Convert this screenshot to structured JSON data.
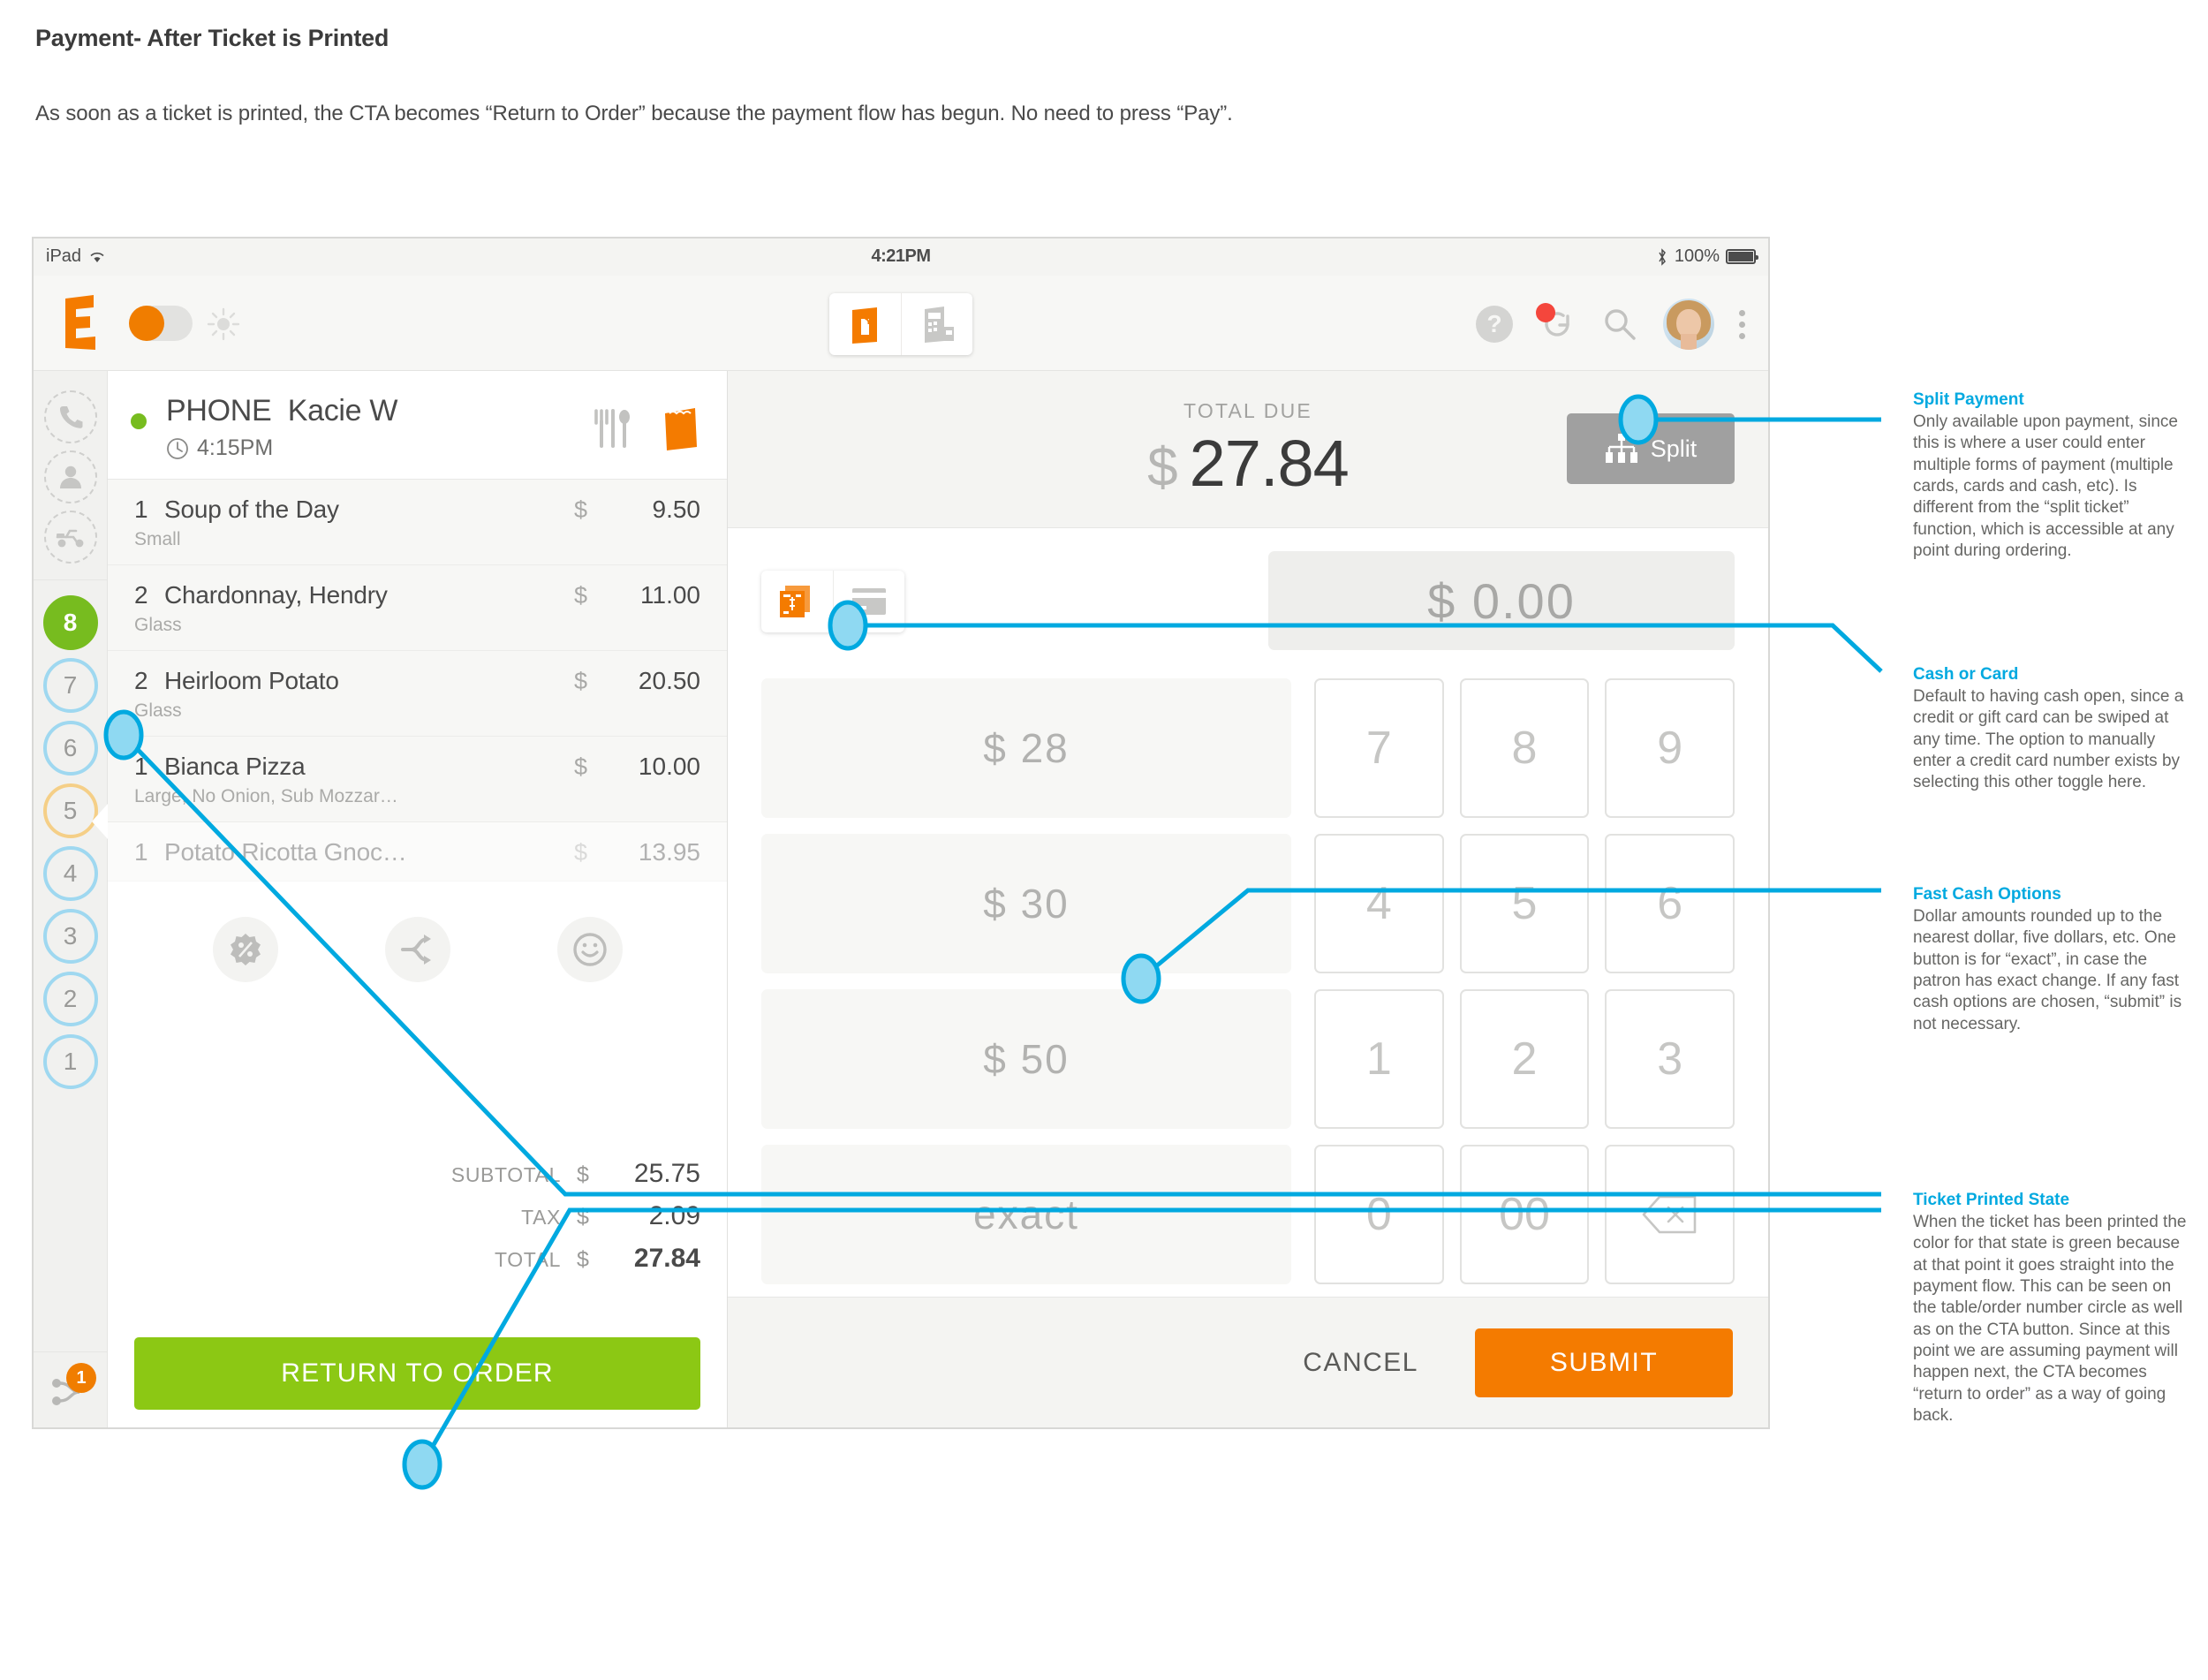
{
  "page": {
    "title": "Payment- After Ticket is Printed",
    "subtitle": "As soon as a ticket is printed, the CTA becomes “Return to Order” because the payment flow has begun. No need to press “Pay”."
  },
  "statusbar": {
    "device": "iPad",
    "time": "4:21PM",
    "battery": "100%"
  },
  "toolbar": {
    "logo": "E",
    "mode_tabs": [
      "order-bag-icon",
      "register-icon"
    ]
  },
  "rail": {
    "top_icons": [
      "phone-icon",
      "person-icon",
      "delivery-scooter-icon"
    ],
    "numbers": [
      {
        "label": "8",
        "state": "green"
      },
      {
        "label": "7",
        "state": "blue"
      },
      {
        "label": "6",
        "state": "blue"
      },
      {
        "label": "5",
        "state": "yellow"
      },
      {
        "label": "4",
        "state": "blue"
      },
      {
        "label": "3",
        "state": "blue"
      },
      {
        "label": "2",
        "state": "blue"
      },
      {
        "label": "1",
        "state": "blue"
      }
    ],
    "bottom_badge": "1"
  },
  "ticket": {
    "order_type": "PHONE",
    "customer": "Kacie W",
    "time": "4:15PM",
    "items": [
      {
        "qty": "1",
        "name": "Soup of the Day",
        "currency": "$",
        "price": "9.50",
        "mod": "Small",
        "faded": false
      },
      {
        "qty": "2",
        "name": "Chardonnay, Hendry",
        "currency": "$",
        "price": "11.00",
        "mod": "Glass",
        "faded": false
      },
      {
        "qty": "2",
        "name": "Heirloom Potato",
        "currency": "$",
        "price": "20.50",
        "mod": "Glass",
        "faded": false
      },
      {
        "qty": "1",
        "name": "Bianca Pizza",
        "currency": "$",
        "price": "10.00",
        "mod": "Large, No Onion, Sub Mozzar…",
        "faded": false
      },
      {
        "qty": "1",
        "name": "Potato Ricotta Gnoc…",
        "currency": "$",
        "price": "13.95",
        "mod": "",
        "faded": true
      }
    ],
    "actions": [
      "discount-icon",
      "split-ticket-icon",
      "smiley-icon"
    ],
    "totals": [
      {
        "label": "SUBTOTAL",
        "currency": "$",
        "value": "25.75",
        "bold": false
      },
      {
        "label": "TAX",
        "currency": "$",
        "value": "2.09",
        "bold": false
      },
      {
        "label": "TOTAL",
        "currency": "$",
        "value": "27.84",
        "bold": true
      }
    ],
    "cta_label": "RETURN TO ORDER"
  },
  "payment": {
    "total_due_label": "TOTAL DUE",
    "total_due_currency": "$",
    "total_due_amount": "27.84",
    "split_label": "Split",
    "payment_types": [
      "cash-icon",
      "credit-card-icon"
    ],
    "amount_entered": "$ 0.00",
    "fast_cash": [
      "$ 28",
      "$ 30",
      "$ 50",
      "exact"
    ],
    "keypad": [
      "7",
      "8",
      "9",
      "4",
      "5",
      "6",
      "1",
      "2",
      "3",
      "0",
      "00",
      "backspace-icon"
    ],
    "cancel_label": "CANCEL",
    "submit_label": "SUBMIT"
  },
  "annotations": [
    {
      "title": "Split Payment",
      "body": "Only available upon payment, since this is where a user could enter multiple forms of payment (multiple cards, cards and cash, etc). Is different from the “split ticket” function, which is accessible at any point during ordering."
    },
    {
      "title": "Cash or Card",
      "body": "Default to having cash open, since a credit or gift card can be swiped at any time. The option to manually enter a credit card number exists by selecting this other toggle here."
    },
    {
      "title": "Fast Cash Options",
      "body": "Dollar amounts rounded up to the nearest dollar, five dollars, etc. One button is for “exact”, in case the patron has exact change. If any fast cash options are chosen, “submit” is not necessary."
    },
    {
      "title": "Ticket Printed State",
      "body": "When the ticket has been printed the color for that state is green because at that point it goes straight into the payment flow. This can be seen on the table/order number circle as well as on the CTA button. Since at this point we are assuming payment will happen next, the CTA becomes “return to order” as a way of going back."
    }
  ],
  "colors": {
    "accent_blue": "#00a9e0",
    "orange": "#f47b00",
    "green": "#8cc814",
    "gray": "#a0a0a0"
  }
}
